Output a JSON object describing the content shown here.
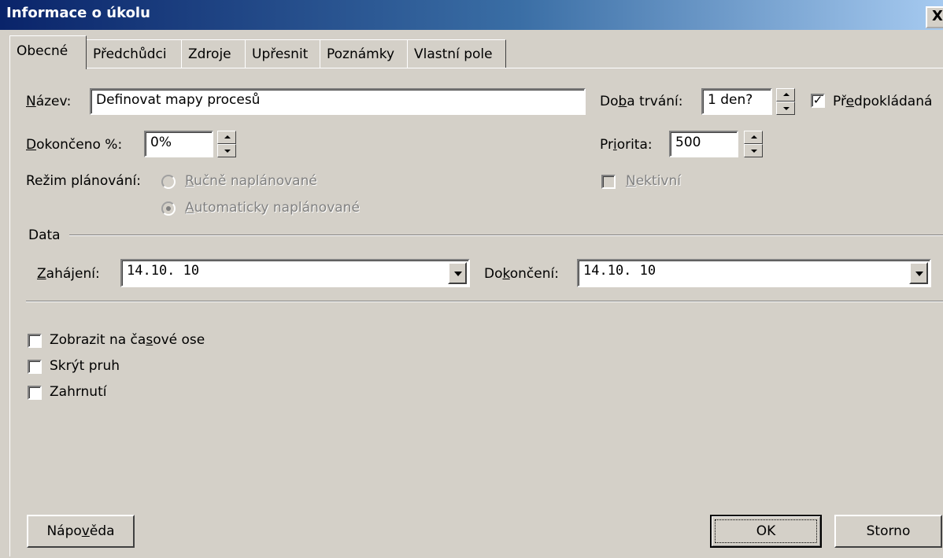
{
  "window": {
    "title": "Informace o úkolu",
    "close": "X"
  },
  "tabs": [
    "Obecné",
    "Předchůdci",
    "Zdroje",
    "Upřesnit",
    "Poznámky",
    "Vlastní pole"
  ],
  "fields": {
    "name": {
      "label_u": "N",
      "label_rest": "ázev:",
      "value": "Definovat mapy procesů"
    },
    "duration": {
      "label_pre": "Do",
      "label_u": "b",
      "label_rest": "a trvání:",
      "value": "1 den?"
    },
    "estimated": {
      "label_pre": "Př",
      "label_u": "e",
      "label_rest": "dpokládaná",
      "checked": "✓"
    },
    "percent": {
      "label_u": "D",
      "label_rest": "okončeno %:",
      "value": "0%"
    },
    "priority": {
      "label_pre": "Pr",
      "label_u": "i",
      "label_rest": "orita:",
      "value": "500"
    },
    "schedule_mode": {
      "label": "Režim plánování:",
      "manual": {
        "u": "R",
        "rest": "učně naplánované"
      },
      "auto": {
        "u": "A",
        "rest": "utomaticky naplánované"
      }
    },
    "inactive": {
      "u": "N",
      "rest": "ektivní"
    }
  },
  "dates": {
    "group_label": "Data",
    "start": {
      "label_u": "Z",
      "label_rest": "ahájení:",
      "value": "14.10. 10"
    },
    "finish": {
      "label_pre": "Do",
      "label_u": "k",
      "label_rest": "ončení:",
      "value": "14.10. 10"
    }
  },
  "options": {
    "timeline": {
      "pre": "Zobrazit na ča",
      "u": "s",
      "rest": "ové ose"
    },
    "hide_bar": "Skrýt pruh",
    "rollup": "Zahrnutí"
  },
  "buttons": {
    "help_pre": "Nápo",
    "help_u": "v",
    "help_rest": "ěda",
    "ok": "OK",
    "cancel": "Storno"
  }
}
